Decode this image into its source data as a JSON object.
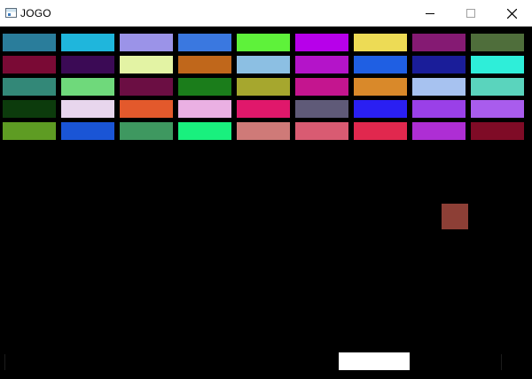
{
  "window": {
    "title": "JOGO"
  },
  "game": {
    "background": "#000000",
    "brick_rows": [
      [
        "#2a7d9b",
        "#1fb6dc",
        "#9b93e8",
        "#3a78e0",
        "#5ef23a",
        "#b700ea",
        "#eddb55",
        "#851a73",
        "#4f6e3b"
      ],
      [
        "#7a0a35",
        "#3b0a55",
        "#e3f3a4",
        "#c0671b",
        "#8cbfe3",
        "#b414c9",
        "#1f5fe3",
        "#1a1d99",
        "#2eeed9"
      ],
      [
        "#338878",
        "#6fd97b",
        "#6b0e43",
        "#1b7d1b",
        "#a6a72e",
        "#c4158f",
        "#d9892a",
        "#a7c2f0",
        "#5ad4bd"
      ],
      [
        "#0c3b0c",
        "#e8d6ed",
        "#e3592c",
        "#eab0e3",
        "#e0186b",
        "#5f5a78",
        "#2a1ff2",
        "#9a40e8",
        "#a95ced"
      ],
      [
        "#5e9c23",
        "#1a55d6",
        "#3e9860",
        "#19f07e",
        "#cf7a78",
        "#d95b72",
        "#e1284e",
        "#ae2ed4",
        "#7f0b26"
      ]
    ],
    "ball_color": "#8d3f36",
    "paddle_color": "#ffffff"
  }
}
